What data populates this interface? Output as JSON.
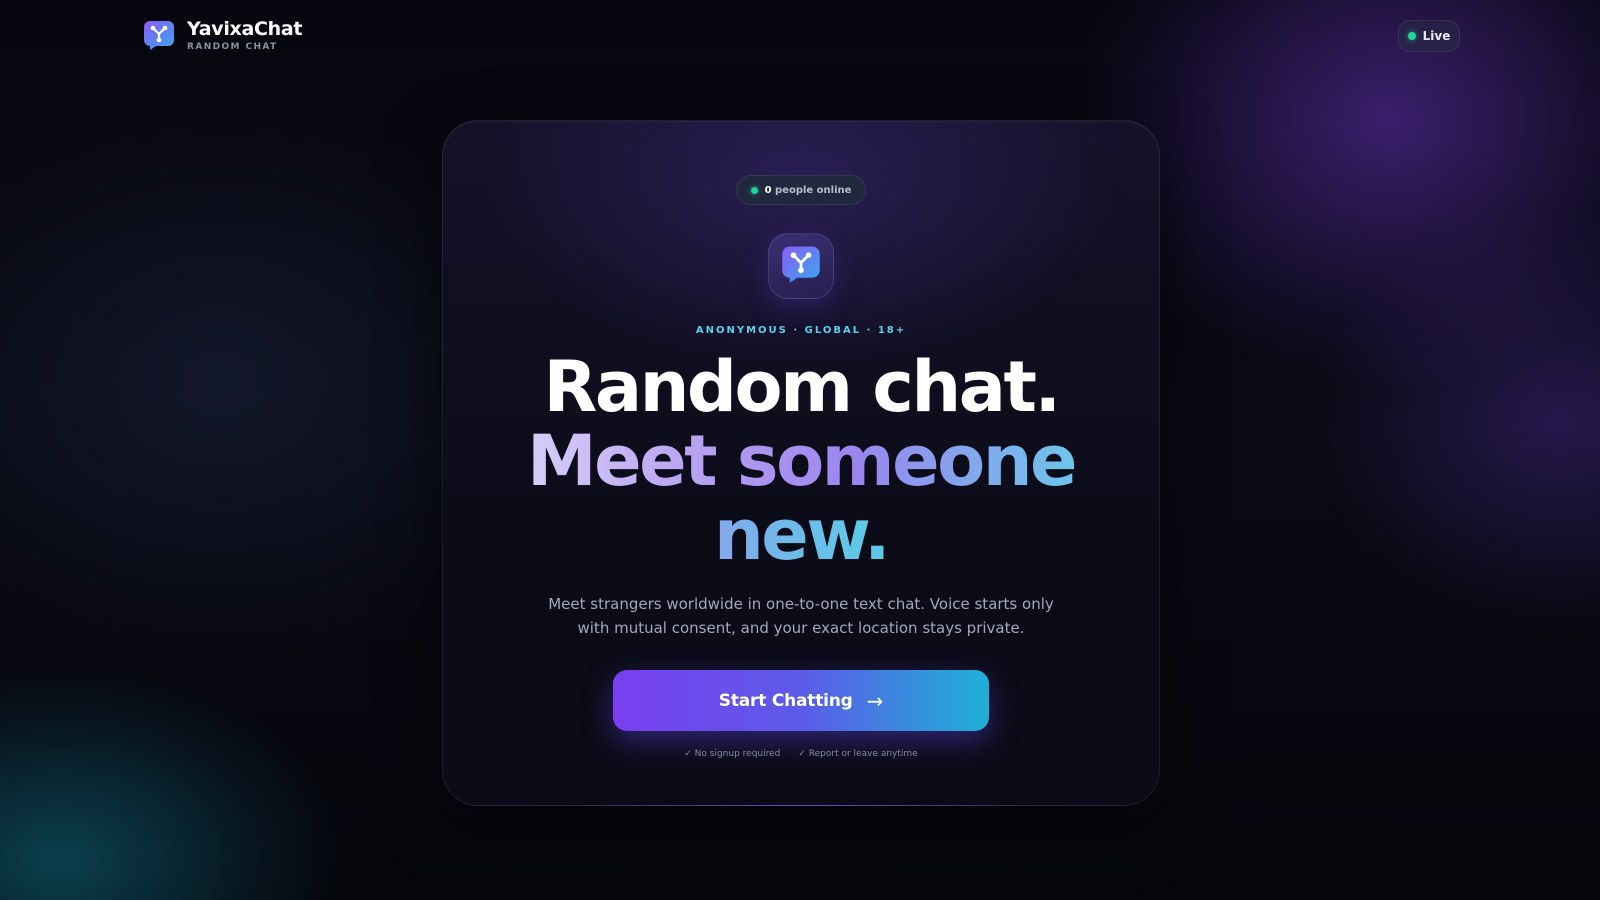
{
  "header": {
    "brand_name": "YavixaChat",
    "brand_sub": "RANDOM CHAT",
    "live_label": "Live"
  },
  "hero": {
    "online_count": "0",
    "online_suffix": "people online",
    "tagline": "ANONYMOUS · GLOBAL · 18+",
    "headline_line1": "Random chat.",
    "headline_line2": "Meet someone",
    "headline_line3": "new.",
    "description": "Meet strangers worldwide in one-to-one text chat. Voice starts only with mutual consent, and your exact location stays private.",
    "cta_label": "Start Chatting",
    "cta_arrow": "→",
    "perk1": "✓ No signup required",
    "perk2": "✓ Report or leave anytime"
  },
  "icons": {
    "logo": "chat-bubble-connection-logo-icon",
    "status": "online-dot-icon",
    "cta": "arrow-right-icon"
  },
  "colors": {
    "accent_purple": "#7a3ff0",
    "accent_cyan": "#1fb0d6",
    "online_green": "#22d39a",
    "tagline_cyan": "#5fd0e8"
  }
}
